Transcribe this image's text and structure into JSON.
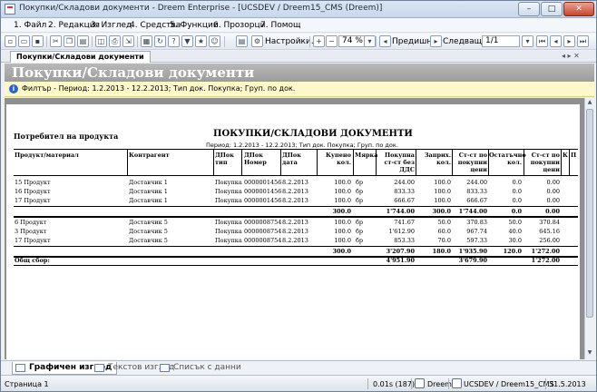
{
  "window": {
    "title": "Покупки/Складови документи - Dreem Enterprise - [UCSDEV / Dreem15_CMS (Dreem)]",
    "min": "–",
    "max": "□",
    "close": "✕"
  },
  "menu": [
    "1. Файл",
    "2. Редакция",
    "3. Изглед",
    "4. Средства",
    "5. Функции",
    "6. Прозорци",
    "7. Помощ"
  ],
  "toolbar": {
    "settings_label": "Настройки...",
    "zoom_value": "74 %",
    "prev_label": "Предишна",
    "next_label": "Следваща",
    "page_value": "1/1"
  },
  "tab": {
    "label": "Покупки/Складови документи",
    "nav": "◂ ▸ ✕"
  },
  "header": {
    "title": "Покупки/Складови документи"
  },
  "filter": {
    "icon": "i",
    "text": "Филтър - Период: 1.2.2013 - 12.2.2013; Тип док. Покупка; Груп. по док."
  },
  "report": {
    "user_label": "Потребител на продукта",
    "title": "ПОКУПКИ/СКЛАДОВИ ДОКУМЕНТИ",
    "subtitle": "Период: 1.2.2013 - 12.2.2013; Тип док. Покупка; Груп. по док.",
    "columns": [
      "Продукт/материал",
      "Контрагент",
      "ДПок тип",
      "ДПок Номер",
      "ДПок дата",
      "Купено кол.",
      "Мярка",
      "Покупна ст-ст без ДДС",
      "Заприх. кол.",
      "Ст-ст по покупни цени",
      "Остатъчно кол.",
      "Ст-ст по покупни цени",
      "К",
      "П"
    ],
    "group1": [
      [
        "15 Продукт",
        "Доставчик 1",
        "Покупка",
        "0000001456",
        "8.2.2013",
        "100.0",
        "бр",
        "244.00",
        "100.0",
        "244.00",
        "0.0",
        "0.00"
      ],
      [
        "16 Продукт",
        "Доставчик 1",
        "Покупка",
        "0000001456",
        "8.2.2013",
        "100.0",
        "бр",
        "833.33",
        "100.0",
        "833.33",
        "0.0",
        "0.00"
      ],
      [
        "17 Продукт",
        "Доставчик 1",
        "Покупка",
        "0000001456",
        "8.2.2013",
        "100.0",
        "бр",
        "666.67",
        "100.0",
        "666.67",
        "0.0",
        "0.00"
      ]
    ],
    "group1_total": [
      "300.0",
      "1'744.00",
      "300.0",
      "1'744.00",
      "0.0",
      "0.00"
    ],
    "group2": [
      [
        "6 Продукт",
        "Доставчик 5",
        "Покупка",
        "0000008754",
        "8.2.2013",
        "100.0",
        "бр",
        "741.67",
        "50.0",
        "370.83",
        "50.0",
        "370.84"
      ],
      [
        "3 Продукт",
        "Доставчик 5",
        "Покупка",
        "0000008754",
        "8.2.2013",
        "100.0",
        "бр",
        "1'612.90",
        "60.0",
        "967.74",
        "40.0",
        "645.16"
      ],
      [
        "17 Продукт",
        "Доставчик 5",
        "Покупка",
        "0000008754",
        "8.2.2013",
        "100.0",
        "бр",
        "853.33",
        "70.0",
        "597.33",
        "30.0",
        "256.00"
      ]
    ],
    "group2_total": [
      "300.0",
      "3'207.90",
      "180.0",
      "1'935.90",
      "120.0",
      "1'272.00"
    ],
    "grand_label": "Общ сбор:",
    "grand_total": [
      "4'951.90",
      "3'679.90",
      "1'272.00"
    ]
  },
  "bottom_tabs": [
    "Графичен изглед",
    "Текстов изглед",
    "Списък с данни"
  ],
  "status": {
    "page": "Страница 1",
    "time": "0.01s (187)",
    "app": "Dreem",
    "db": "UCSDEV / Dreem15_CMS",
    "date": "31.5.2013"
  }
}
